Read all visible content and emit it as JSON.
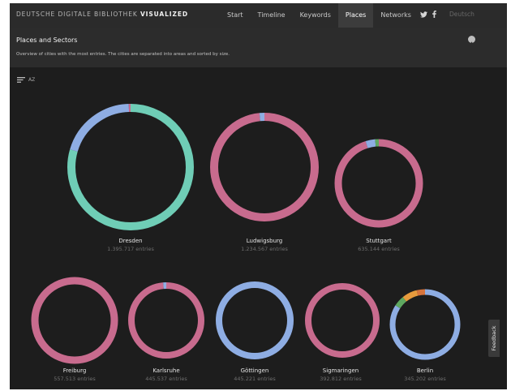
{
  "brand": {
    "prefix": "DEUTSCHE DIGITALE BIBLIOTHEK",
    "emphasis": "VISUALIZED"
  },
  "nav": [
    {
      "label": "Start"
    },
    {
      "label": "Timeline"
    },
    {
      "label": "Keywords"
    },
    {
      "label": "Places",
      "active": true
    },
    {
      "label": "Networks"
    }
  ],
  "social": [
    {
      "icon": "twitter-icon"
    },
    {
      "icon": "facebook-icon"
    }
  ],
  "language": "Deutsch",
  "panel": {
    "title": "Places and Sectors",
    "subtitle": "Overview of cities with the most entries. The cities are separated into areas and sorted by size.",
    "info_icon": "info-icon"
  },
  "sort": {
    "icon": "sort-icon",
    "label": "AZ"
  },
  "feedback": "Feedback",
  "colors": {
    "teal": "#6fcdb6",
    "blue": "#8eade3",
    "pink": "#c86b8e",
    "green": "#5fa860",
    "orange": "#e79b3d",
    "dark_orange": "#d6743c"
  },
  "cities": [
    {
      "name": "Dresden",
      "count": "1.395.717 entries",
      "segments": [
        {
          "color": "#6fcdb6",
          "fraction": 0.795
        },
        {
          "color": "#8eade3",
          "fraction": 0.2
        },
        {
          "color": "#c86b8e",
          "fraction": 0.005
        }
      ]
    },
    {
      "name": "Ludwigsburg",
      "count": "1.234.567 entries",
      "segments": [
        {
          "color": "#c86b8e",
          "fraction": 0.985
        },
        {
          "color": "#8eade3",
          "fraction": 0.015
        }
      ]
    },
    {
      "name": "Stuttgart",
      "count": "635.144 entries",
      "segments": [
        {
          "color": "#c86b8e",
          "fraction": 0.95
        },
        {
          "color": "#8eade3",
          "fraction": 0.035
        },
        {
          "color": "#5fa860",
          "fraction": 0.015
        }
      ]
    },
    {
      "name": "Freiburg",
      "count": "557.513 entries",
      "segments": [
        {
          "color": "#c86b8e",
          "fraction": 1.0
        }
      ]
    },
    {
      "name": "Karlsruhe",
      "count": "445.537 entries",
      "segments": [
        {
          "color": "#c86b8e",
          "fraction": 0.985
        },
        {
          "color": "#8eade3",
          "fraction": 0.015
        }
      ]
    },
    {
      "name": "Göttingen",
      "count": "445.221 entries",
      "segments": [
        {
          "color": "#8eade3",
          "fraction": 1.0
        }
      ]
    },
    {
      "name": "Sigmaringen",
      "count": "392.812 entries",
      "segments": [
        {
          "color": "#c86b8e",
          "fraction": 1.0
        }
      ]
    },
    {
      "name": "Berlin",
      "count": "345.202 entries",
      "segments": [
        {
          "color": "#8eade3",
          "fraction": 0.84
        },
        {
          "color": "#5fa860",
          "fraction": 0.05
        },
        {
          "color": "#e79b3d",
          "fraction": 0.07
        },
        {
          "color": "#d6743c",
          "fraction": 0.04
        }
      ]
    }
  ]
}
